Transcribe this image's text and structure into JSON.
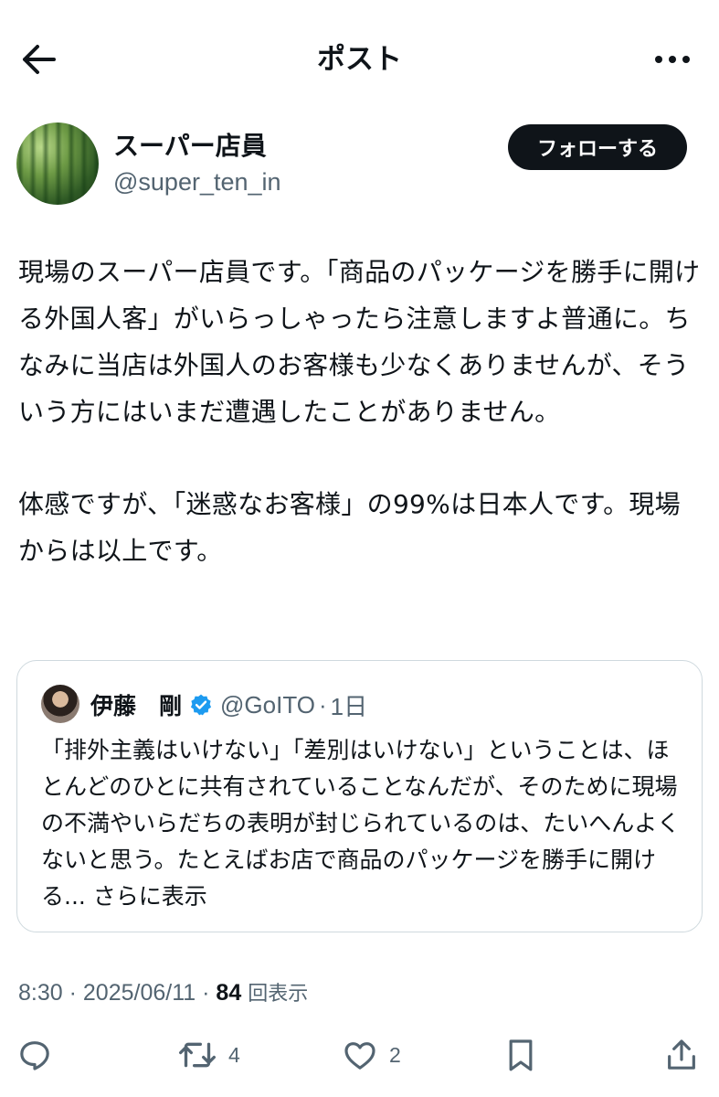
{
  "header": {
    "title": "ポスト"
  },
  "author": {
    "name": "スーパー店員",
    "handle": "@super_ten_in",
    "follow_label": "フォローする"
  },
  "post": {
    "paragraph1": "現場のスーパー店員です。「商品のパッケージを勝手に開ける外国人客」がいらっしゃったら注意しますよ普通に。ちなみに当店は外国人のお客様も少なくありませんが、そういう方にはいまだ遭遇したことがありません。",
    "paragraph2": "体感ですが、「迷惑なお客様」の99%は日本人です。現場からは以上です。"
  },
  "quote": {
    "name": "伊藤　剛",
    "handle": "@GoITO",
    "separator": "·",
    "time": "1日",
    "body": "「排外主義はいけない」「差別はいけない」ということは、ほとんどのひとに共有されていることなんだが、そのために現場の不満やいらだちの表明が封じられているのは、たいへんよくないと思う。たとえばお店で商品のパッケージを勝手に開ける...",
    "show_more": "さらに表示"
  },
  "meta": {
    "time": "8:30",
    "sep1": "·",
    "date": "2025/06/11",
    "sep2": "·",
    "views_count": "84",
    "views_label": "回表示"
  },
  "actions": {
    "retweet_count": "4",
    "like_count": "2"
  },
  "icons": {
    "back": "arrow-left-icon",
    "more": "more-icon",
    "verified": "verified-icon",
    "reply": "reply-icon",
    "retweet": "retweet-icon",
    "like": "heart-icon",
    "bookmark": "bookmark-icon",
    "share": "share-icon"
  },
  "colors": {
    "text": "#0f1419",
    "secondary": "#536471",
    "verified": "#1d9bf0",
    "border": "#cfd9de"
  }
}
